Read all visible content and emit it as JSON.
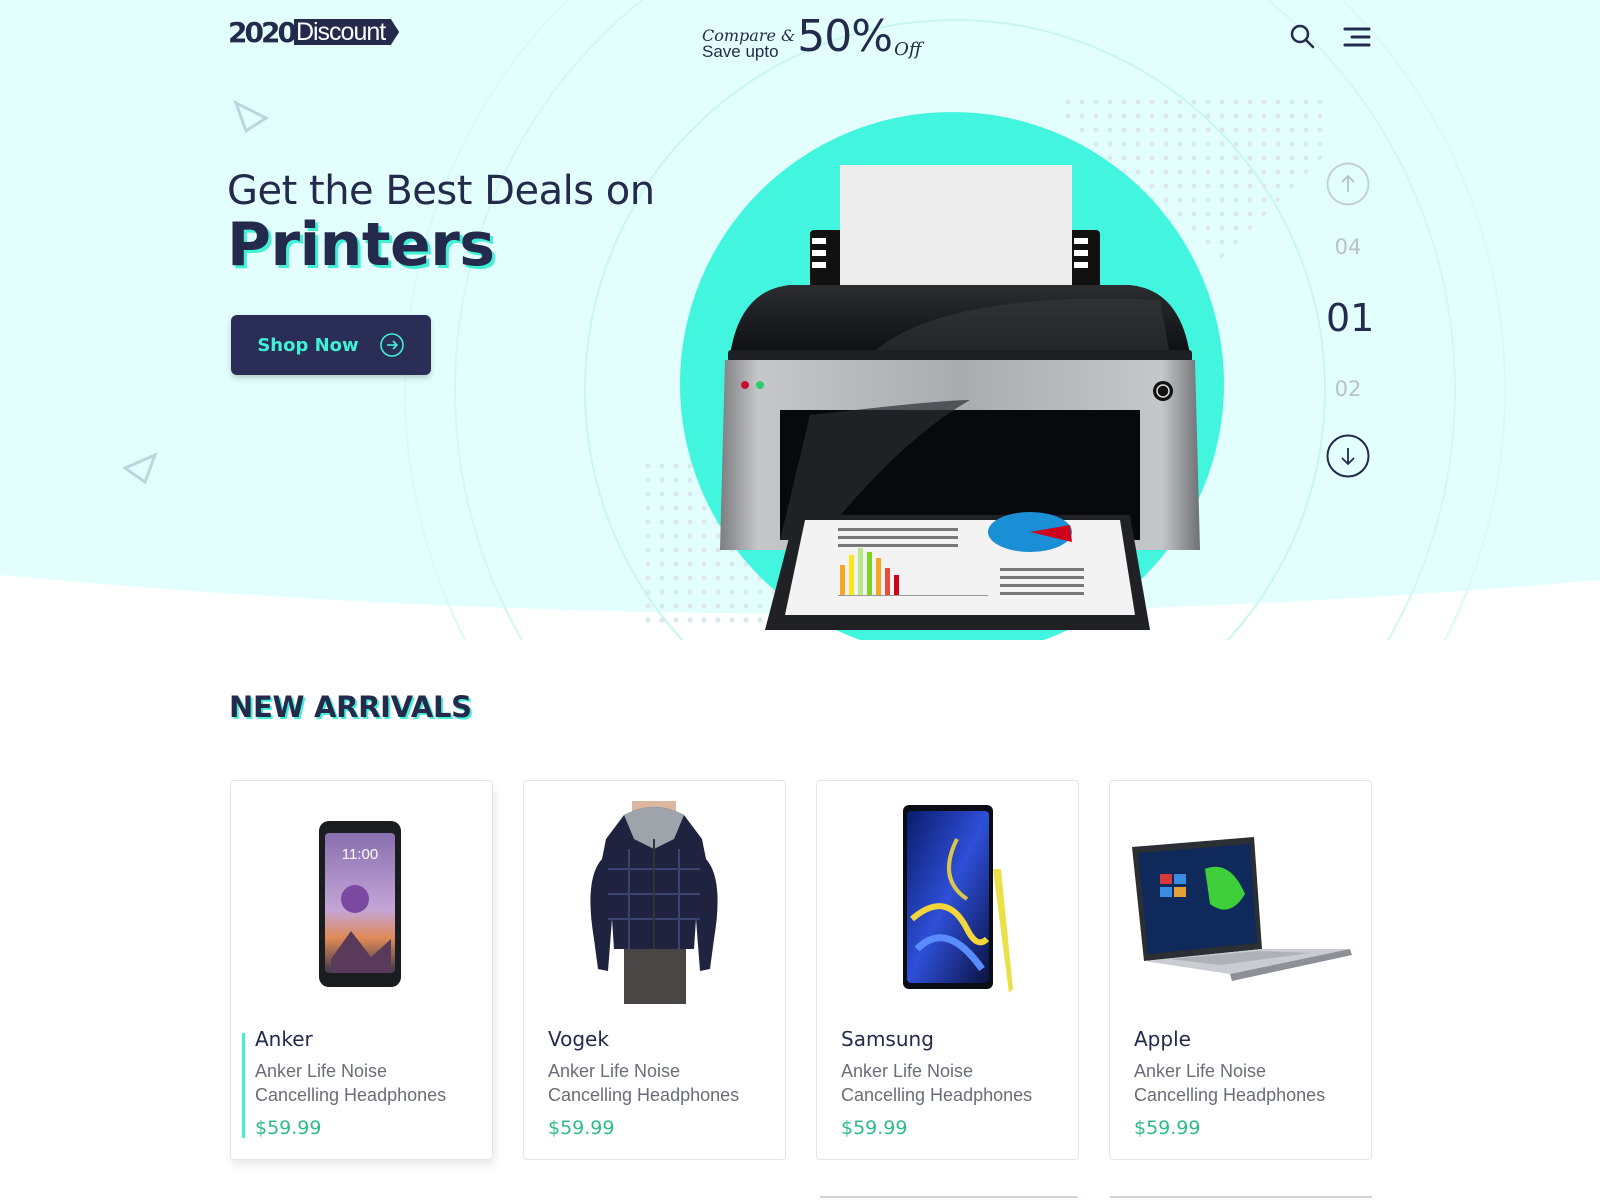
{
  "header": {
    "logo_year": "2020",
    "logo_text": "Discount",
    "promo_line1": "Compare &",
    "promo_line2": "Save upto",
    "promo_big": "50%",
    "promo_off": "Off",
    "search_icon": "search-icon",
    "menu_icon": "hamburger-menu-icon"
  },
  "hero": {
    "subtitle": "Get the Best Deals on",
    "title": "Printers",
    "cta_label": "Shop Now",
    "cta_icon": "arrow-right-circle-icon",
    "product_image": "printer"
  },
  "slider": {
    "prev_icon": "arrow-up-circle-icon",
    "next_icon": "arrow-down-circle-icon",
    "prev_num": "04",
    "current_num": "01",
    "next_num": "02"
  },
  "new_arrivals": {
    "title": "NEW ARRIVALS",
    "products": [
      {
        "brand": "Anker",
        "desc": "Anker Life Noise Cancelling Headphones",
        "price": "$59.99",
        "image": "smartphone"
      },
      {
        "brand": "Vogek",
        "desc": "Anker Life Noise Cancelling Headphones",
        "price": "$59.99",
        "image": "jacket"
      },
      {
        "brand": "Samsung",
        "desc": "Anker Life Noise Cancelling Headphones",
        "price": "$59.99",
        "image": "galaxy-phone"
      },
      {
        "brand": "Apple",
        "desc": "Anker Life Noise Cancelling Headphones",
        "price": "$59.99",
        "image": "laptop"
      }
    ]
  },
  "colors": {
    "navy": "#232a4b",
    "accent_mint": "#41f1d7",
    "hero_bg": "#e3fffd",
    "price_green": "#2dbc8a"
  }
}
